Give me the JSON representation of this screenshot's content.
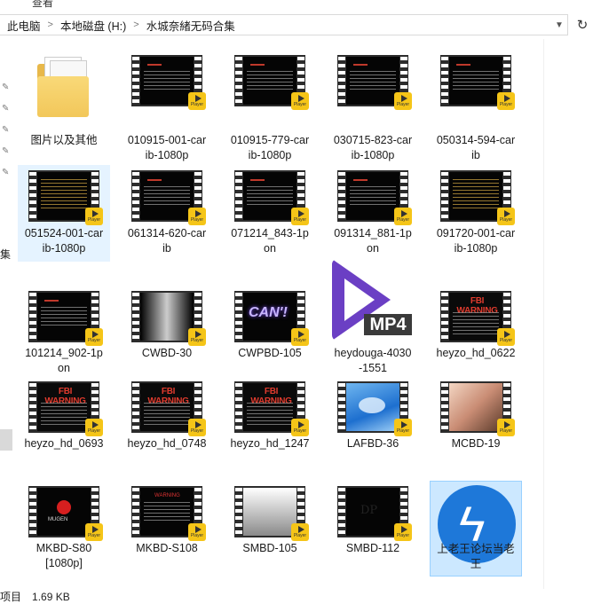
{
  "ribbon": {
    "cut_tabs": [
      "查看"
    ]
  },
  "address": {
    "crumbs": [
      "此电脑",
      "本地磁盘 (H:)",
      "水城奈緒无码合集"
    ],
    "separator": ">"
  },
  "status": {
    "items": "项目",
    "size": "1.69 KB"
  },
  "icons": {
    "pin": "pin-icon",
    "dropdown": "chevron-down-icon",
    "refresh": "refresh-icon"
  },
  "files": [
    {
      "label": "图片以及其他",
      "kind": "folder"
    },
    {
      "label": "010915-001-caribib-1080p",
      "display": "010915-001-car\nib-1080p",
      "kind": "video",
      "screen": "text"
    },
    {
      "label": "010915-779-car ib-1080p",
      "display": "010915-779-car\nib-1080p",
      "kind": "video",
      "screen": "text"
    },
    {
      "label": "030715-823-car ib-1080p",
      "display": "030715-823-car\nib-1080p",
      "kind": "video",
      "screen": "text"
    },
    {
      "label": "050314-594-car ib",
      "display": "050314-594-car\nib",
      "kind": "video",
      "screen": "text"
    },
    {
      "label": "051524-001-car ib-1080p",
      "display": "051524-001-car\nib-1080p",
      "kind": "video",
      "screen": "gold"
    },
    {
      "label": "061314-620-car ib",
      "display": "061314-620-car\nib",
      "kind": "video",
      "screen": "text"
    },
    {
      "label": "071214_843-1p on",
      "display": "071214_843-1p\non",
      "kind": "video",
      "screen": "text"
    },
    {
      "label": "091314_881-1p on",
      "display": "091314_881-1p\non",
      "kind": "video",
      "screen": "text"
    },
    {
      "label": "091720-001-car ib-1080p",
      "display": "091720-001-car\nib-1080p",
      "kind": "video",
      "screen": "gold"
    },
    {
      "label": "101214_902-1p on",
      "display": "101214_902-1p\non",
      "kind": "video",
      "screen": "text"
    },
    {
      "label": "CWBD-30",
      "display": "CWBD-30",
      "kind": "video",
      "screen": "fade"
    },
    {
      "label": "CWPBD-105",
      "display": "CWPBD-105",
      "kind": "video",
      "screen": "neon"
    },
    {
      "label": "heydouga-4030 -1551",
      "display": "heydouga-4030\n-1551",
      "kind": "mp4"
    },
    {
      "label": "heyzo_hd_0622",
      "display": "heyzo_hd_0622",
      "kind": "video",
      "screen": "fbi"
    },
    {
      "label": "heyzo_hd_0693",
      "display": "heyzo_hd_0693",
      "kind": "video",
      "screen": "fbi"
    },
    {
      "label": "heyzo_hd_0748",
      "display": "heyzo_hd_0748",
      "kind": "video",
      "screen": "fbi"
    },
    {
      "label": "heyzo_hd_1247",
      "display": "heyzo_hd_1247",
      "kind": "video",
      "screen": "fbi"
    },
    {
      "label": "LAFBD-36",
      "display": "LAFBD-36",
      "kind": "video",
      "screen": "sky"
    },
    {
      "label": "MCBD-19",
      "display": "MCBD-19",
      "kind": "video",
      "screen": "photo"
    },
    {
      "label": "MKBD-S80 [1080p]",
      "display": "MKBD-S80\n[1080p]",
      "kind": "video",
      "screen": "logo"
    },
    {
      "label": "MKBD-S108",
      "display": "MKBD-S108",
      "kind": "video",
      "screen": "warn"
    },
    {
      "label": "SMBD-105",
      "display": "SMBD-105",
      "kind": "video",
      "screen": "grad"
    },
    {
      "label": "SMBD-112",
      "display": "SMBD-112",
      "kind": "video",
      "screen": "dp"
    },
    {
      "label": "上老王论坛当老王",
      "display": "上老王论坛当老\n王",
      "kind": "app"
    }
  ],
  "thumb_text": {
    "fbi": "FBI WARNING",
    "neon": "CAN'!",
    "logo": "MUGEN",
    "warn": "WARNING",
    "dp": "DP",
    "mp4": "MP4",
    "player": "Player"
  },
  "state": {
    "selected": "上老王论坛当老王",
    "hover": "051524-001-car ib-1080p"
  }
}
